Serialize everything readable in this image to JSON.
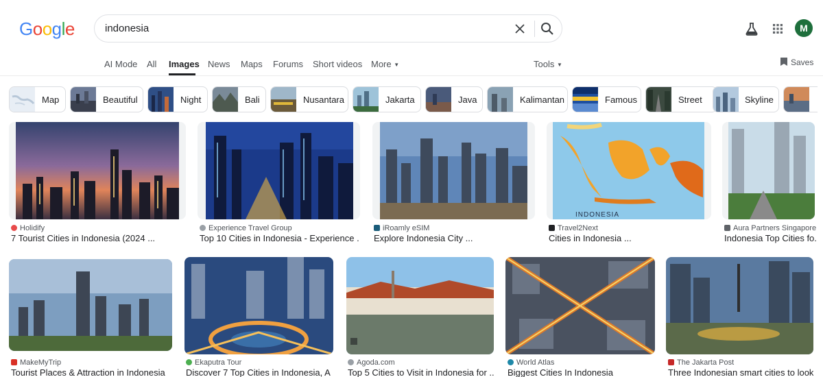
{
  "logo": {
    "letters": [
      "G",
      "o",
      "o",
      "g",
      "l",
      "e"
    ],
    "colors": [
      "#4285F4",
      "#EA4335",
      "#FBBC05",
      "#4285F4",
      "#34A853",
      "#EA4335"
    ]
  },
  "search": {
    "query": "indonesia"
  },
  "header": {
    "avatar_letter": "M",
    "avatar_color": "#1e6f3c"
  },
  "tabs": [
    {
      "label": "AI Mode"
    },
    {
      "label": "All"
    },
    {
      "label": "Images"
    },
    {
      "label": "News"
    },
    {
      "label": "Maps"
    },
    {
      "label": "Forums"
    },
    {
      "label": "Short videos"
    },
    {
      "label": "More"
    }
  ],
  "tools_label": "Tools",
  "saves_label": "Saves",
  "chips": [
    {
      "label": "Map"
    },
    {
      "label": "Beautiful"
    },
    {
      "label": "Night"
    },
    {
      "label": "Bali"
    },
    {
      "label": "Nusantara"
    },
    {
      "label": "Jakarta"
    },
    {
      "label": "Java"
    },
    {
      "label": "Kalimantan"
    },
    {
      "label": "Famous"
    },
    {
      "label": "Street"
    },
    {
      "label": "Skyline"
    }
  ],
  "results": [
    {
      "source": "Holidify",
      "title": "7 Tourist Cities in Indonesia (2024 ...",
      "fav_color": "#e84b4b"
    },
    {
      "source": "Experience Travel Group",
      "title": "Top 10 Cities in Indonesia - Experience ...",
      "fav_color": "#9aa0a6"
    },
    {
      "source": "iRoamly eSIM",
      "title": "Explore Indonesia City ...",
      "fav_color": "#1a5c7a"
    },
    {
      "source": "Travel2Next",
      "title": "Cities in Indonesia ...",
      "fav_color": "#202124"
    },
    {
      "source": "Aura Partners Singapore",
      "title": "Indonesia Top Cities fo...",
      "fav_color": "#5f6368"
    },
    {
      "source": "MakeMyTrip",
      "title": "Tourist Places & Attraction in Indonesia",
      "fav_color": "#d93025"
    },
    {
      "source": "Ekaputra Tour",
      "title": "Discover 7 Top Cities in Indonesia, A ...",
      "fav_color": "#4caf50"
    },
    {
      "source": "Agoda.com",
      "title": "Top 5 Cities to Visit in Indonesia for ...",
      "fav_color": "#9aa0a6"
    },
    {
      "source": "World Atlas",
      "title": "Biggest Cities In Indonesia",
      "fav_color": "#1e88a8"
    },
    {
      "source": "The Jakarta Post",
      "title": "Three Indonesian smart cities to look ...",
      "fav_color": "#c62828"
    }
  ],
  "map_label": "INDONESIA"
}
